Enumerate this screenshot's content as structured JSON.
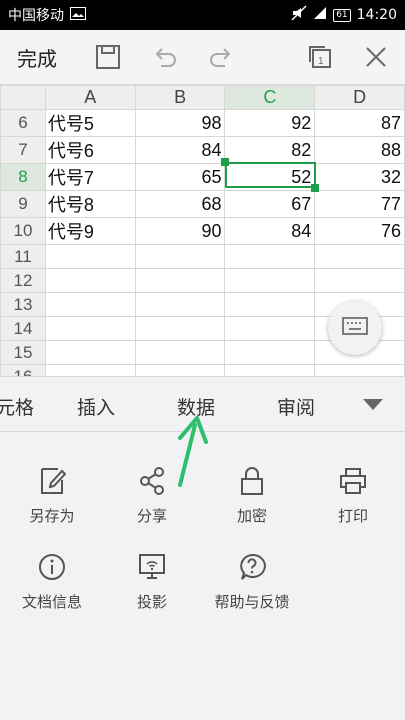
{
  "status_bar": {
    "carrier": "中国移动",
    "battery": "61",
    "time": "14:20"
  },
  "toolbar": {
    "done_label": "完成"
  },
  "sheet": {
    "columns": [
      "A",
      "B",
      "C",
      "D"
    ],
    "active_column": "C",
    "active_row": "8",
    "rows": [
      {
        "row": "6",
        "cells": [
          "代号5",
          "98",
          "92",
          "87"
        ]
      },
      {
        "row": "7",
        "cells": [
          "代号6",
          "84",
          "82",
          "88"
        ]
      },
      {
        "row": "8",
        "cells": [
          "代号7",
          "65",
          "52",
          "32"
        ]
      },
      {
        "row": "9",
        "cells": [
          "代号8",
          "68",
          "67",
          "77"
        ]
      },
      {
        "row": "10",
        "cells": [
          "代号9",
          "90",
          "84",
          "76"
        ]
      },
      {
        "row": "11",
        "cells": [
          "",
          "",
          "",
          ""
        ]
      },
      {
        "row": "12",
        "cells": [
          "",
          "",
          "",
          ""
        ]
      },
      {
        "row": "13",
        "cells": [
          "",
          "",
          "",
          ""
        ]
      },
      {
        "row": "14",
        "cells": [
          "",
          "",
          "",
          ""
        ]
      },
      {
        "row": "15",
        "cells": [
          "",
          "",
          "",
          ""
        ]
      },
      {
        "row": "16",
        "cells": [
          "",
          "",
          "",
          ""
        ]
      }
    ]
  },
  "tabs": [
    "元格",
    "插入",
    "数据",
    "审阅"
  ],
  "menu": {
    "save_as": "另存为",
    "share": "分享",
    "encrypt": "加密",
    "print": "打印",
    "doc_info": "文档信息",
    "projection": "投影",
    "help_feedback": "帮助与反馈"
  },
  "colors": {
    "accent": "#1e9e4a",
    "arrow": "#2dbf6e"
  }
}
